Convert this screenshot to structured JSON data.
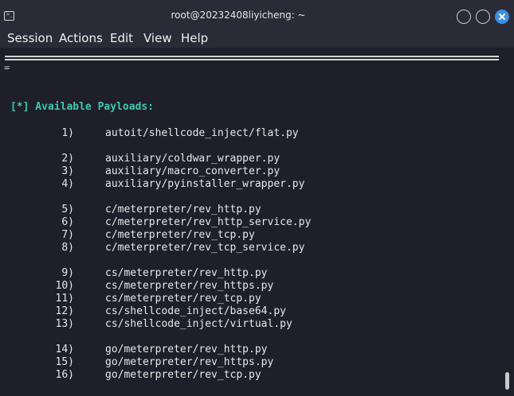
{
  "window": {
    "title": "root@20232408liyicheng: ~"
  },
  "menu": {
    "items": [
      "Session",
      "Actions",
      "Edit",
      "View",
      "Help"
    ]
  },
  "terminal": {
    "equals_line": "=",
    "header": "[*] Available Payloads:",
    "payloads": [
      {
        "num": "1)",
        "path": "autoit/shellcode_inject/flat.py"
      },
      {
        "num": "2)",
        "path": "auxiliary/coldwar_wrapper.py"
      },
      {
        "num": "3)",
        "path": "auxiliary/macro_converter.py"
      },
      {
        "num": "4)",
        "path": "auxiliary/pyinstaller_wrapper.py"
      },
      {
        "num": "5)",
        "path": "c/meterpreter/rev_http.py"
      },
      {
        "num": "6)",
        "path": "c/meterpreter/rev_http_service.py"
      },
      {
        "num": "7)",
        "path": "c/meterpreter/rev_tcp.py"
      },
      {
        "num": "8)",
        "path": "c/meterpreter/rev_tcp_service.py"
      },
      {
        "num": "9)",
        "path": "cs/meterpreter/rev_http.py"
      },
      {
        "num": "10)",
        "path": "cs/meterpreter/rev_https.py"
      },
      {
        "num": "11)",
        "path": "cs/meterpreter/rev_tcp.py"
      },
      {
        "num": "12)",
        "path": "cs/shellcode_inject/base64.py"
      },
      {
        "num": "13)",
        "path": "cs/shellcode_inject/virtual.py"
      },
      {
        "num": "14)",
        "path": "go/meterpreter/rev_http.py"
      },
      {
        "num": "15)",
        "path": "go/meterpreter/rev_https.py"
      },
      {
        "num": "16)",
        "path": "go/meterpreter/rev_tcp.py"
      }
    ]
  },
  "colors": {
    "header_accent": "#3ec7b3",
    "background": "#1e1f29",
    "close_button": "#3d8fe0"
  }
}
